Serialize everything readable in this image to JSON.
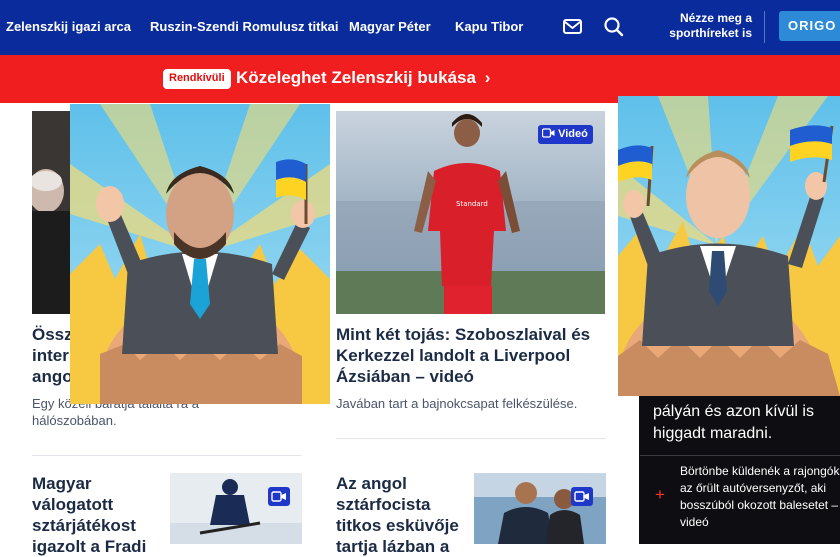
{
  "nav": {
    "links": [
      "Zelenszkij igazi arca",
      "Ruszin-Szendi Romulusz titkai",
      "Magyar Péter",
      "Kapu Tibor"
    ],
    "sport_link": "Nézze meg a sporthíreket is",
    "origo_button": "ORIGO S"
  },
  "breaking": {
    "badge": "Rendkívüli",
    "text": "Közeleghet Zelenszkij bukása",
    "arrow": "›"
  },
  "articles": {
    "left_main": {
      "headline": "Össz… inter… ango…",
      "headline_lines": [
        "Össz",
        "inter",
        "ango"
      ],
      "lead": "Egy közeli barátja találta rá a hálószobában."
    },
    "center_main": {
      "video_label": "Videó",
      "headline": "Mint két tojás: Szoboszlaival és Kerkezzel landolt a Liverpool Ázsiában – videó",
      "lead": "Javában tart a bajnokcsapat felkészülése."
    },
    "left_small": {
      "headline": "Magyar válogatott sztárjátékost igazolt a Fradi"
    },
    "center_small": {
      "headline": "Az angol sztárfocista titkos esküvője tartja lázban a"
    },
    "right_dark": {
      "headline": "pályán és azon kívül is higgadt maradni.",
      "item": "Börtönbe küldenék a rajongók az őrült autóversenyzőt, aki bosszúból okozott balesetet – videó"
    }
  },
  "colors": {
    "nav_bg": "#0a2b9c",
    "breaking_bg": "#f01e1e",
    "accent": "#2c8ad6",
    "video_badge": "#2038c9",
    "headline": "#1c2b45"
  },
  "icons": [
    "mail-icon",
    "search-icon",
    "video-camera-icon",
    "chevron-right-icon",
    "plus-icon"
  ]
}
